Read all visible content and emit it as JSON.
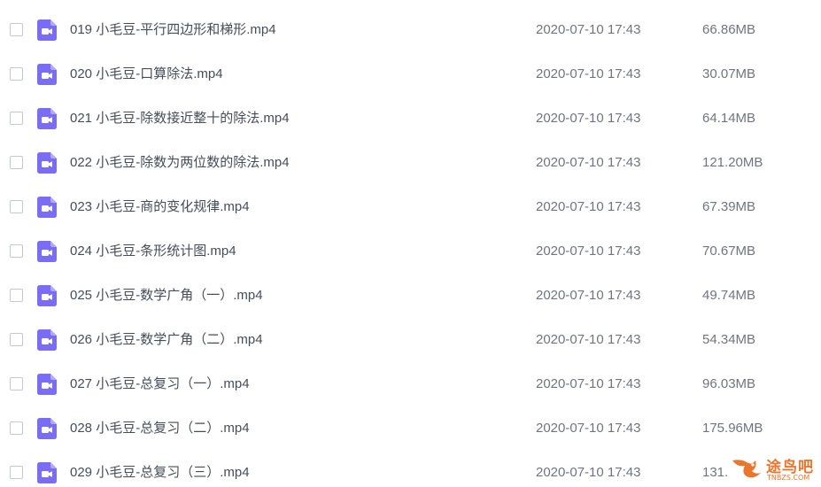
{
  "files": [
    {
      "name": "019 小毛豆-平行四边形和梯形.mp4",
      "date": "2020-07-10 17:43",
      "size": "66.86MB"
    },
    {
      "name": "020 小毛豆-口算除法.mp4",
      "date": "2020-07-10 17:43",
      "size": "30.07MB"
    },
    {
      "name": "021 小毛豆-除数接近整十的除法.mp4",
      "date": "2020-07-10 17:43",
      "size": "64.14MB"
    },
    {
      "name": "022 小毛豆-除数为两位数的除法.mp4",
      "date": "2020-07-10 17:43",
      "size": "121.20MB"
    },
    {
      "name": "023 小毛豆-商的变化规律.mp4",
      "date": "2020-07-10 17:43",
      "size": "67.39MB"
    },
    {
      "name": "024 小毛豆-条形统计图.mp4",
      "date": "2020-07-10 17:43",
      "size": "70.67MB"
    },
    {
      "name": "025 小毛豆-数学广角（一）.mp4",
      "date": "2020-07-10 17:43",
      "size": "49.74MB"
    },
    {
      "name": "026 小毛豆-数学广角（二）.mp4",
      "date": "2020-07-10 17:43",
      "size": "54.34MB"
    },
    {
      "name": "027 小毛豆-总复习（一）.mp4",
      "date": "2020-07-10 17:43",
      "size": "96.03MB"
    },
    {
      "name": "028 小毛豆-总复习（二）.mp4",
      "date": "2020-07-10 17:43",
      "size": "175.96MB"
    },
    {
      "name": "029 小毛豆-总复习（三）.mp4",
      "date": "2020-07-10 17:43",
      "size": "131."
    }
  ],
  "icon": {
    "name": "video-file-icon",
    "color": "#7b6cf6"
  },
  "watermark": {
    "text": "途鸟吧",
    "subtext": "TNBZS.COM",
    "color": "#e9752e"
  }
}
